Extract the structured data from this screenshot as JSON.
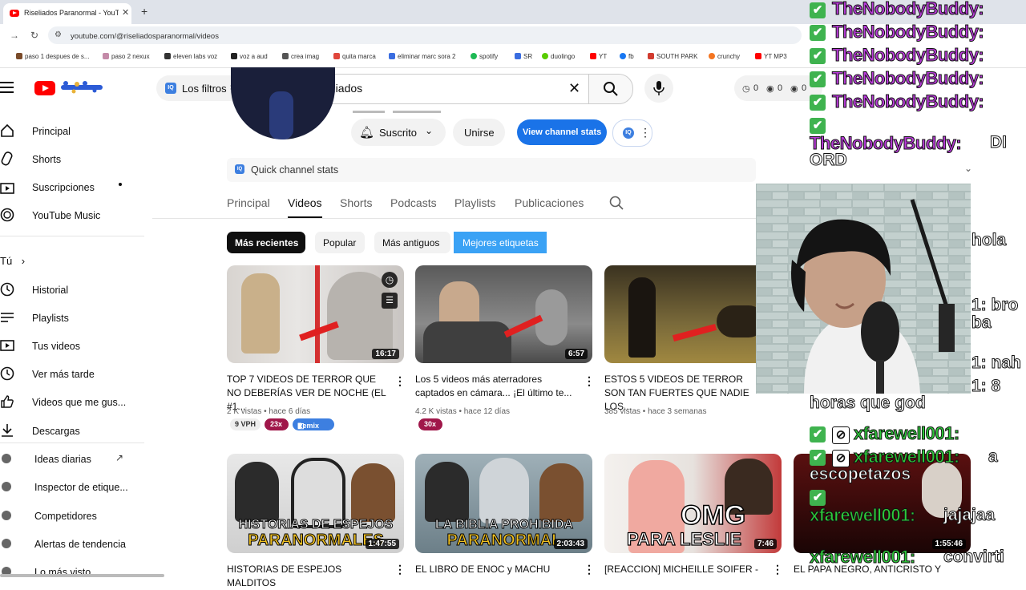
{
  "browser": {
    "tab_title": "Riseliados Paranormal - YouTube",
    "url": "youtube.com/@riseliadosparanormal/videos",
    "bookmarks": [
      "paso 1 despues de s...",
      "paso 2 nexux",
      "eleven labs voz",
      "voz a aud",
      "crea imag",
      "quita marca",
      "eliminar marc sora 2",
      "spotify",
      "SR",
      "duolingo",
      "YT",
      "fb",
      "SOUTH PARK",
      "crunchy",
      "YT MP3"
    ]
  },
  "header": {
    "filters_label": "Los filtros",
    "search_value": "riseliados",
    "stats": [
      "0",
      "0",
      "0"
    ]
  },
  "sidebar": {
    "main": [
      "Principal",
      "Shorts",
      "Suscripciones",
      "YouTube Music"
    ],
    "you_label": "Tú",
    "you_items": [
      "Historial",
      "Playlists",
      "Tus videos",
      "Ver más tarde",
      "Videos que me gus...",
      "Descargas"
    ],
    "ext_items": [
      "Ideas diarias",
      "Inspector de etique...",
      "Competidores",
      "Alertas de tendencia",
      "Lo más visto"
    ]
  },
  "channel": {
    "subscribed_label": "Suscrito",
    "join_label": "Unirse",
    "view_stats_label": "View channel stats",
    "quick_stats_label": "Quick channel stats",
    "tabs": [
      "Principal",
      "Videos",
      "Shorts",
      "Podcasts",
      "Playlists",
      "Publicaciones"
    ],
    "chips": [
      "Más recientes",
      "Popular",
      "Más antiguos",
      "Mejores etiquetas"
    ]
  },
  "videos": [
    {
      "title": "TOP 7 VIDEOS DE TERROR QUE NO DEBERÍAS VER DE NOCHE (EL #1...",
      "meta": "2 K vistas • hace 6 días",
      "duration": "16:17",
      "vph": "9 VPH",
      "mult": "23x",
      "remix": "Remix"
    },
    {
      "title": "Los 5 videos más aterradores captados en cámara... ¡El último te...",
      "meta": "4.2 K vistas • hace 12 días",
      "duration": "6:57",
      "mult": "30x"
    },
    {
      "title": "ESTOS 5 VIDEOS DE TERROR SON TAN FUERTES QUE NADIE LOS...",
      "meta": "385 vistas • hace 3 semanas"
    },
    {
      "title": "HISTORIAS DE ESPEJOS MALDITOS",
      "duration": "1:47:55",
      "overlay": "HISTORIAS DE ESPEJOS",
      "overlay2": "PARANORMALES"
    },
    {
      "title": "EL LIBRO DE ENOC y MACHU",
      "duration": "2:03:43",
      "overlay": "LA BIBLIA PROHIBIDA",
      "overlay2": "PARANORMAL"
    },
    {
      "title": "[REACCION] MICHEILLE SOIFER -",
      "duration": "7:46",
      "overlay": "OMG",
      "overlay2": "PARA LESLIE"
    },
    {
      "title": "EL PAPA NEGRO, ANTICRISTO Y",
      "duration": "1:55:46"
    }
  ],
  "chat": {
    "names": [
      "TheNobodyBuddy:",
      "TheNobodyBuddy:",
      "TheNobodyBuddy:",
      "TheNobodyBuddy:",
      "TheNobodyBuddy:",
      "TheNobodyBuddy:"
    ],
    "m1": "DI",
    "m1b": "ORD",
    "m2": "hola",
    "m3": "1: bro",
    "m3b": "ba",
    "m4": "1: nah",
    "m5": "1: 8",
    "m5b": "horas que god",
    "f_names": [
      "xfarewell001:",
      "xfarewell001:",
      "xfarewell001:",
      "xfarewell001:"
    ],
    "f1b": "a",
    "f1c": "escopetazos",
    "f2": "jajajaa",
    "f3": "convirti"
  },
  "colors": {
    "accent": "#1a73e8",
    "brand": "#ff0000",
    "chat_purple": "#b83bd8",
    "chat_green": "#2ec93a"
  }
}
